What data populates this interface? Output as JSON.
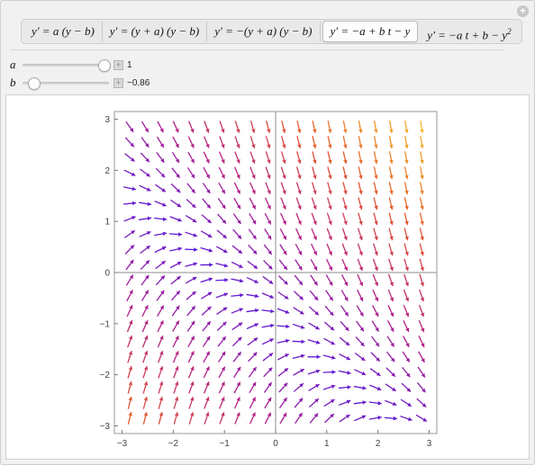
{
  "tabs": [
    {
      "label": "y' = a (y − b)"
    },
    {
      "label": "y' = (y + a) (y − b)"
    },
    {
      "label": "y' = −(y + a) (y − b)"
    },
    {
      "label": "y' = −a + b t − y",
      "active": true
    },
    {
      "label": "y' = −a t + b − y",
      "sup": "2"
    }
  ],
  "controls": {
    "a": {
      "label": "a",
      "value": "1",
      "numeric": 1,
      "min": -1,
      "max": 1
    },
    "b": {
      "label": "b",
      "value": "−0.86",
      "numeric": -0.86,
      "min": -1,
      "max": 1
    }
  },
  "icons": {
    "corner": "plus-circle-icon",
    "stepper": "plus-square-icon"
  },
  "chart_data": {
    "type": "vector-field",
    "equation": "y' = −a + b t − y",
    "params": {
      "a": 1,
      "b": -0.86
    },
    "xlim": [
      -3.15,
      3.15
    ],
    "ylim": [
      -3.15,
      3.15
    ],
    "x_ticks": [
      "−3",
      "−2",
      "−1",
      "0",
      "1",
      "2",
      "3"
    ],
    "y_ticks": [
      "3",
      "2",
      "1",
      "0",
      "−1",
      "−2",
      "−3"
    ],
    "grid_count": 20,
    "grid_range": [
      -2.85,
      2.85
    ],
    "colormap": [
      "#5b19d6",
      "#b31f88",
      "#e4572b",
      "#f6b72a"
    ]
  }
}
